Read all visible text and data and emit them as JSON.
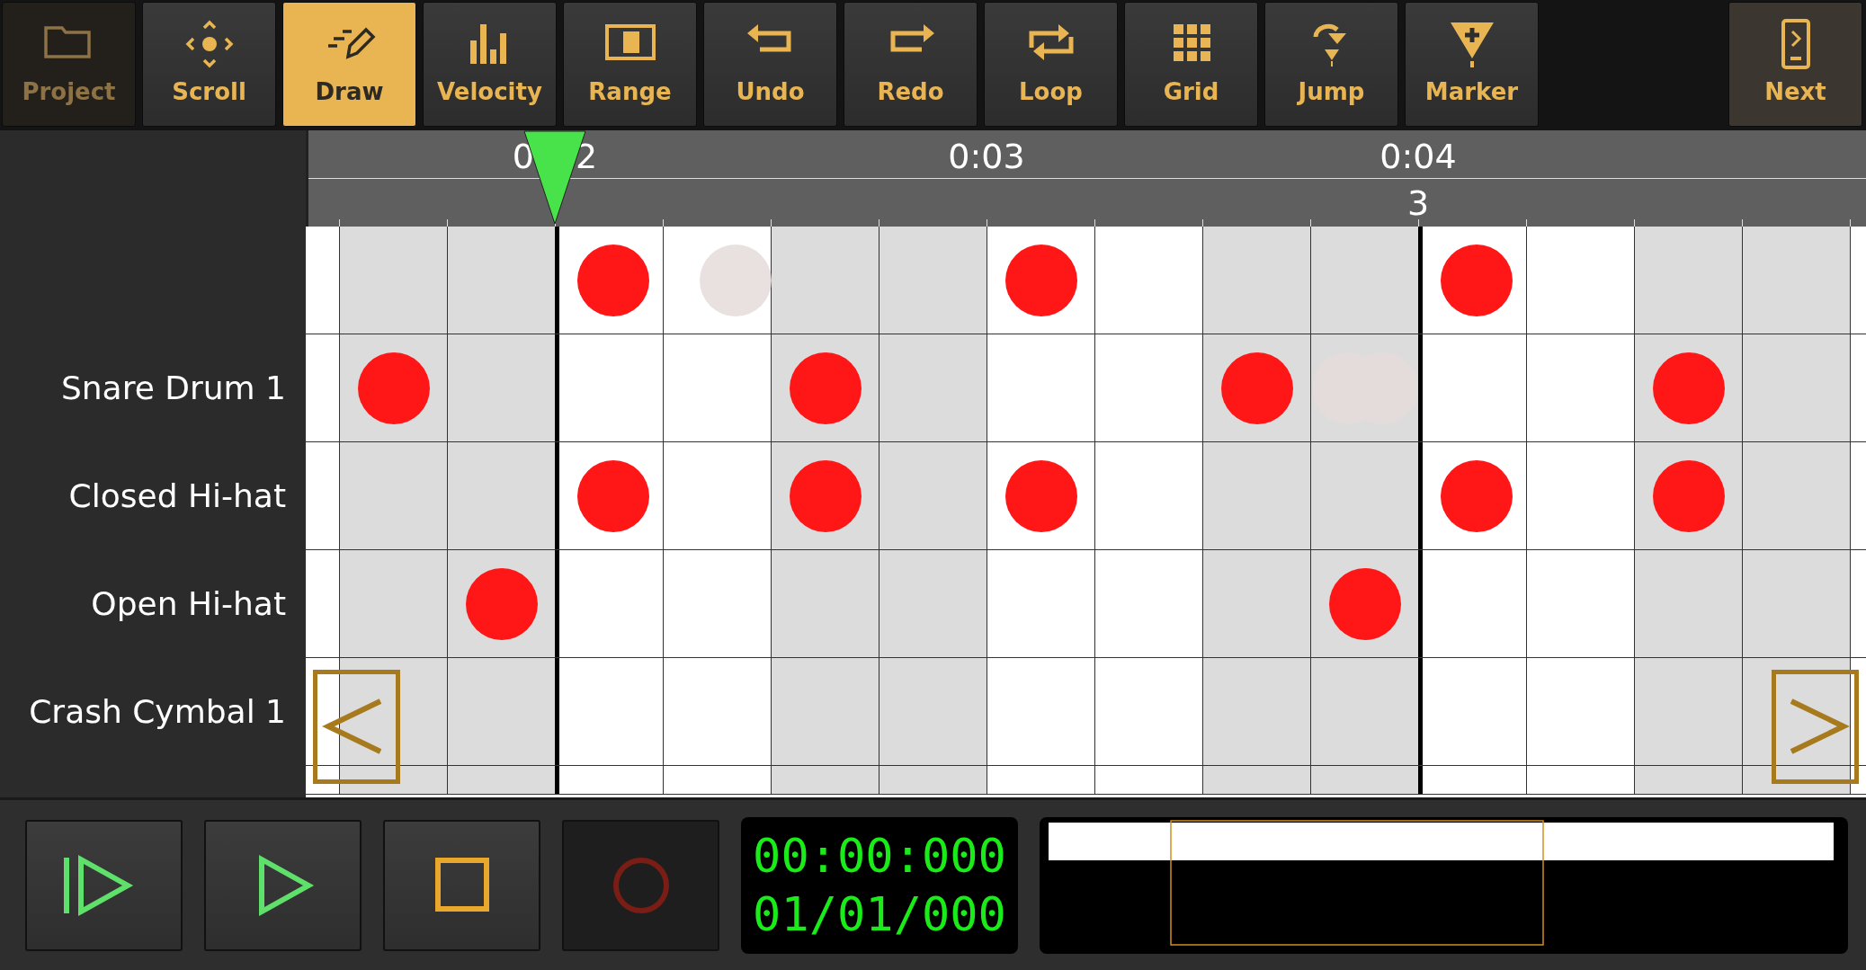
{
  "toolbar": [
    {
      "label": "Project",
      "kind": "project",
      "selected": false,
      "disabled": true
    },
    {
      "label": "Scroll",
      "kind": "scroll",
      "selected": false,
      "disabled": false
    },
    {
      "label": "Draw",
      "kind": "draw",
      "selected": true,
      "disabled": false
    },
    {
      "label": "Velocity",
      "kind": "velocity",
      "selected": false,
      "disabled": false
    },
    {
      "label": "Range",
      "kind": "range",
      "selected": false,
      "disabled": false
    },
    {
      "label": "Undo",
      "kind": "undo",
      "selected": false,
      "disabled": false
    },
    {
      "label": "Redo",
      "kind": "redo",
      "selected": false,
      "disabled": false
    },
    {
      "label": "Loop",
      "kind": "loop",
      "selected": false,
      "disabled": false
    },
    {
      "label": "Grid",
      "kind": "grid",
      "selected": false,
      "disabled": false
    },
    {
      "label": "Jump",
      "kind": "jump",
      "selected": false,
      "disabled": false
    },
    {
      "label": "Marker",
      "kind": "marker",
      "selected": false,
      "disabled": false
    }
  ],
  "next_button": {
    "label": "Next"
  },
  "timeline": {
    "times": [
      [
        "0",
        "2"
      ],
      [
        "0:03"
      ],
      [
        "0:04"
      ]
    ],
    "bars": [
      "3"
    ]
  },
  "tracks": [
    {
      "cells": [
        {
          "kind": "empty"
        },
        {
          "kind": "empty"
        },
        {
          "kind": "note"
        },
        {
          "kind": "ghost"
        },
        {
          "kind": "empty"
        },
        {
          "kind": "empty"
        },
        {
          "kind": "note"
        },
        {
          "kind": "empty"
        },
        {
          "kind": "empty"
        },
        {
          "kind": "empty"
        },
        {
          "kind": "note"
        },
        {
          "kind": "empty"
        },
        {
          "kind": "empty"
        },
        {
          "kind": "empty"
        }
      ]
    },
    {
      "name": "Snare Drum 1",
      "cells": [
        {
          "kind": "note"
        },
        {
          "kind": "empty"
        },
        {
          "kind": "empty"
        },
        {
          "kind": "empty"
        },
        {
          "kind": "note"
        },
        {
          "kind": "empty"
        },
        {
          "kind": "empty"
        },
        {
          "kind": "empty"
        },
        {
          "kind": "note"
        },
        {
          "kind": "double-ghost"
        },
        {
          "kind": "empty"
        },
        {
          "kind": "empty"
        },
        {
          "kind": "note"
        },
        {
          "kind": "empty"
        }
      ]
    },
    {
      "name": "Closed Hi-hat",
      "cells": [
        {
          "kind": "empty"
        },
        {
          "kind": "empty"
        },
        {
          "kind": "note"
        },
        {
          "kind": "empty"
        },
        {
          "kind": "note"
        },
        {
          "kind": "empty"
        },
        {
          "kind": "note"
        },
        {
          "kind": "empty"
        },
        {
          "kind": "empty"
        },
        {
          "kind": "empty"
        },
        {
          "kind": "note"
        },
        {
          "kind": "empty"
        },
        {
          "kind": "note"
        },
        {
          "kind": "empty"
        }
      ]
    },
    {
      "name": "Open Hi-hat",
      "cells": [
        {
          "kind": "empty"
        },
        {
          "kind": "note"
        },
        {
          "kind": "empty"
        },
        {
          "kind": "empty"
        },
        {
          "kind": "empty"
        },
        {
          "kind": "empty"
        },
        {
          "kind": "empty"
        },
        {
          "kind": "empty"
        },
        {
          "kind": "empty"
        },
        {
          "kind": "note"
        },
        {
          "kind": "empty"
        },
        {
          "kind": "empty"
        },
        {
          "kind": "empty"
        },
        {
          "kind": "empty"
        }
      ]
    },
    {
      "name": "Crash Cymbal 1",
      "cells": [
        {
          "kind": "empty"
        },
        {
          "kind": "empty"
        },
        {
          "kind": "empty"
        },
        {
          "kind": "empty"
        },
        {
          "kind": "empty"
        },
        {
          "kind": "empty"
        },
        {
          "kind": "empty"
        },
        {
          "kind": "empty"
        },
        {
          "kind": "empty"
        },
        {
          "kind": "empty"
        },
        {
          "kind": "empty"
        },
        {
          "kind": "empty"
        },
        {
          "kind": "empty"
        },
        {
          "kind": "empty"
        }
      ]
    }
  ],
  "transport": [
    {
      "kind": "rewind"
    },
    {
      "kind": "play"
    },
    {
      "kind": "stop"
    },
    {
      "kind": "record"
    }
  ],
  "counter": {
    "time": "00:00:000",
    "position": "01/01/000"
  }
}
